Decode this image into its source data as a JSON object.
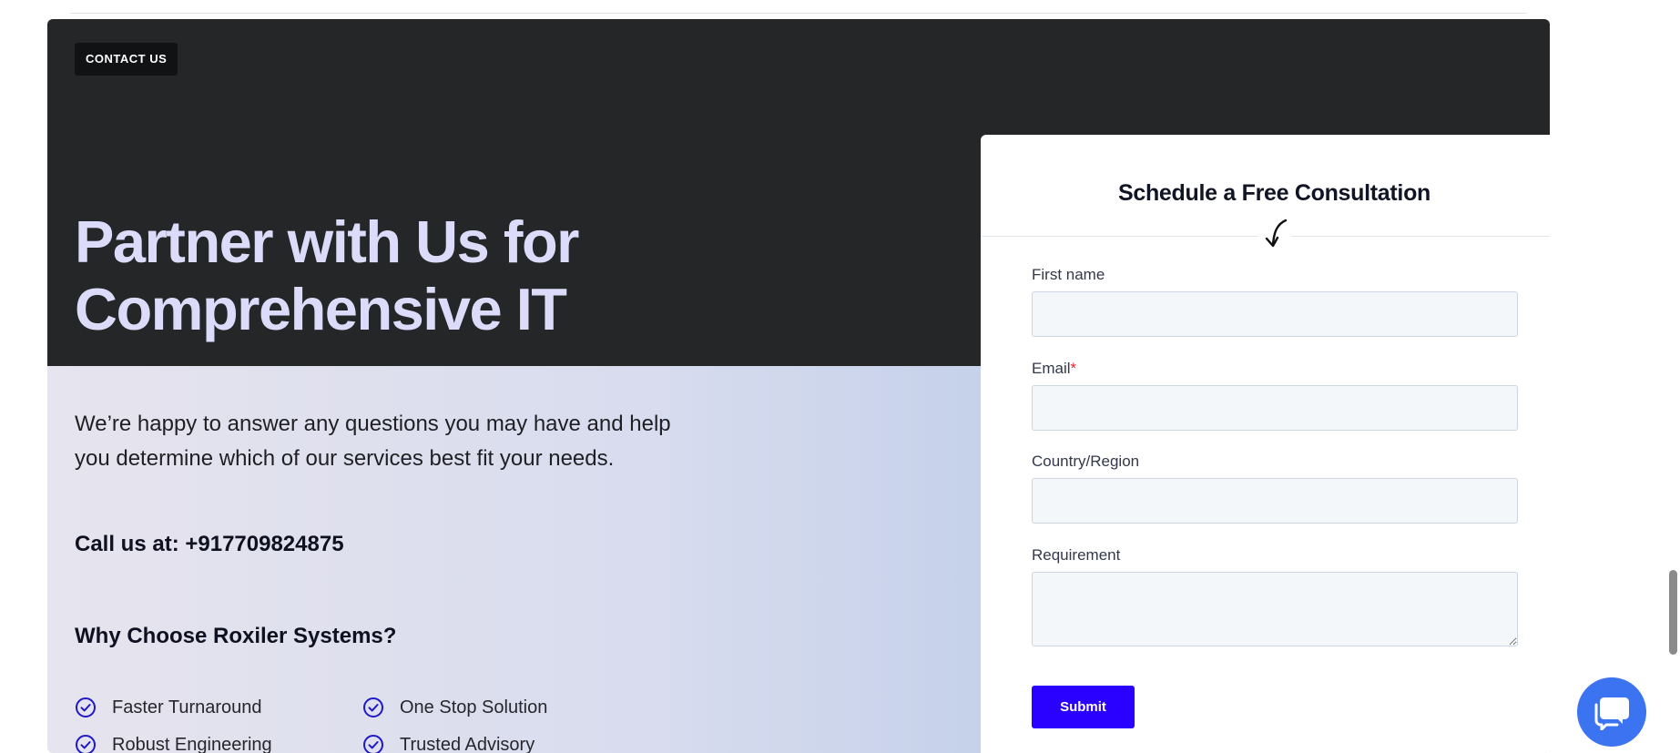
{
  "section": {
    "badge": "CONTACT US",
    "headline_line1": "Partner with Us for",
    "headline_line2": "Comprehensive IT",
    "intro_line1": "We’re happy to answer any questions you may have and help",
    "intro_line2": "you determine which of our services best fit your needs.",
    "call": "Call us at: +917709824875",
    "why_title": "Why Choose Roxiler Systems?",
    "features": [
      "Faster Turnaround",
      "One Stop Solution",
      "Robust Engineering",
      "Trusted Advisory"
    ]
  },
  "form": {
    "title": "Schedule a Free Consultation",
    "first_name_label": "First name",
    "email_label": "Email",
    "email_required_marker": "*",
    "country_label": "Country/Region",
    "requirement_label": "Requirement",
    "first_name_value": "",
    "email_value": "",
    "country_value": "",
    "requirement_value": "",
    "submit_label": "Submit"
  },
  "icons": {
    "check": "check-circle-icon",
    "arrow": "curved-arrow-down-icon",
    "chat": "chat-bubbles-icon"
  },
  "colors": {
    "dark_background": "#252628",
    "headline": "#dcdcfa",
    "check_accent": "#1f18c8",
    "submit": "#2a00ff",
    "chat_button": "#3b73f0",
    "required": "#e0262f"
  }
}
